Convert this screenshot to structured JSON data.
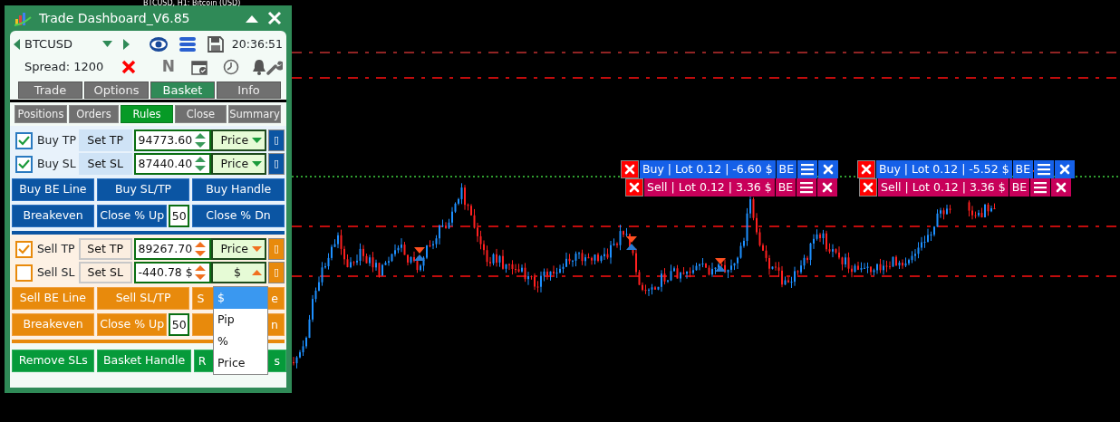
{
  "chart": {
    "title": "BTCUSD, H1:  Bitcoin (USD)"
  },
  "panel": {
    "title": "Trade Dashboard_V6.85",
    "symbol": "BTCUSD",
    "time": "20:36:51",
    "spread": "Spread: 1200",
    "news": "N"
  },
  "tabs": [
    {
      "label": "Trade",
      "selected": false
    },
    {
      "label": "Options",
      "selected": false
    },
    {
      "label": "Basket",
      "selected": true
    },
    {
      "label": "Info",
      "selected": false
    }
  ],
  "subtabs": [
    {
      "label": "Positions",
      "selected": false
    },
    {
      "label": "Orders",
      "selected": false
    },
    {
      "label": "Rules",
      "selected": true
    },
    {
      "label": "Close",
      "selected": false
    },
    {
      "label": "Summary",
      "selected": false
    }
  ],
  "sections": [
    {
      "kind": "buy",
      "rows": [
        {
          "label": "Buy TP",
          "checked": true,
          "button": "Set TP",
          "value": "94773.60",
          "unit": "Price",
          "open": false,
          "extra": "▯"
        },
        {
          "label": "Buy SL",
          "checked": true,
          "button": "Set SL",
          "value": "87440.40",
          "unit": "Price",
          "open": false,
          "extra": "▯"
        }
      ],
      "buttons": [
        "Buy BE Line",
        "Buy SL/TP",
        "Buy Handle"
      ],
      "breakeven": "Breakeven",
      "close_up": "Close % Up",
      "percent": "50",
      "close_dn": "Close % Dn"
    },
    {
      "kind": "sell",
      "rows": [
        {
          "label": "Sell TP",
          "checked": true,
          "button": "Set TP",
          "value": "89267.70",
          "unit": "Price",
          "open": false,
          "extra": "▯"
        },
        {
          "label": "Sell SL",
          "checked": false,
          "button": "Set SL",
          "value": "-440.78 $",
          "unit": "$",
          "open": true,
          "extra": "▯"
        }
      ],
      "buttons": [
        "Sell BE Line",
        "Sell SL/TP",
        {
          "left": "S",
          "right": "e"
        }
      ],
      "breakeven": "Breakeven",
      "close_up": "Close % Up",
      "percent": "50",
      "close_dn": {
        "right": "n"
      }
    }
  ],
  "basket_buttons": [
    "Remove SLs",
    "Basket Handle",
    {
      "left": "R",
      "right": "s"
    }
  ],
  "dropdown": {
    "options": [
      {
        "label": "$",
        "selected": true
      },
      {
        "label": "Pip",
        "selected": false
      },
      {
        "label": "%",
        "selected": false
      },
      {
        "label": "Price",
        "selected": false
      }
    ]
  },
  "order_labels": [
    {
      "kind": "buy",
      "text": "Buy | Lot 0.12 | -6.60 $",
      "be": "BE"
    },
    {
      "kind": "sell",
      "text": "Sell | Lot 0.12 | 3.36 $",
      "be": "BE"
    },
    {
      "kind": "buy",
      "text": "Buy | Lot 0.12 | -5.52 $",
      "be": "BE"
    },
    {
      "kind": "sell",
      "text": "Sell | Lot 0.12 | 3.36 $",
      "be": "BE"
    }
  ]
}
